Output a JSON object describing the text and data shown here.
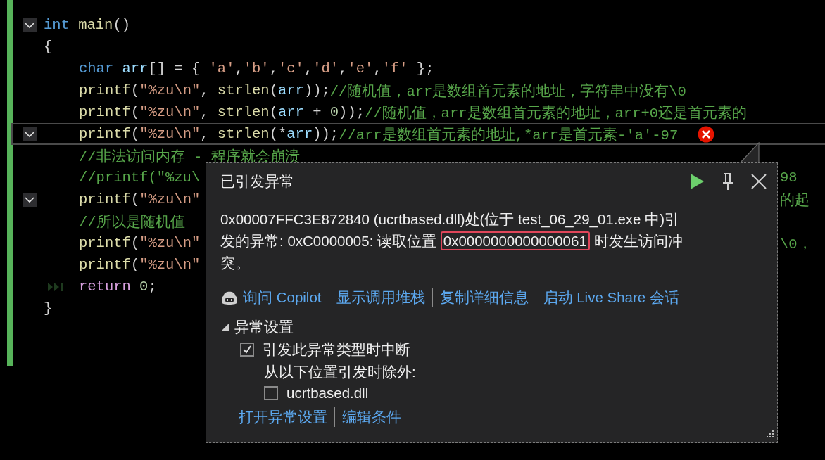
{
  "code_lines": [
    {
      "indented": false,
      "fold": true,
      "current": false,
      "error": false,
      "next_statement": false,
      "tokens": [
        {
          "kind": "keyword",
          "text": "int"
        },
        {
          "kind": "func",
          "text": "main"
        },
        {
          "kind": "plain",
          "text": "()"
        }
      ]
    },
    {
      "indented": false,
      "fold": false,
      "current": false,
      "error": false,
      "next_statement": false,
      "tokens": [
        {
          "kind": "plain",
          "text": "{"
        }
      ]
    },
    {
      "indented": true,
      "fold": false,
      "current": false,
      "error": false,
      "next_statement": false,
      "tokens": [
        {
          "kind": "keyword",
          "text": "char"
        },
        {
          "kind": "var",
          "text": "arr"
        },
        {
          "kind": "plain",
          "text": "[] = { "
        },
        {
          "kind": "string",
          "text": "'a'"
        },
        {
          "kind": "plain",
          "text": ","
        },
        {
          "kind": "string",
          "text": "'b'"
        },
        {
          "kind": "plain",
          "text": ","
        },
        {
          "kind": "string",
          "text": "'c'"
        },
        {
          "kind": "plain",
          "text": ","
        },
        {
          "kind": "string",
          "text": "'d'"
        },
        {
          "kind": "plain",
          "text": ","
        },
        {
          "kind": "string",
          "text": "'e'"
        },
        {
          "kind": "plain",
          "text": ","
        },
        {
          "kind": "string",
          "text": "'f'"
        },
        {
          "kind": "plain",
          "text": " };"
        }
      ]
    },
    {
      "indented": true,
      "fold": false,
      "current": false,
      "error": false,
      "next_statement": false,
      "tokens": [
        {
          "kind": "func",
          "text": "printf"
        },
        {
          "kind": "plain",
          "text": "("
        },
        {
          "kind": "string",
          "text": "\"%zu\\n\""
        },
        {
          "kind": "plain",
          "text": ", "
        },
        {
          "kind": "func",
          "text": "strlen"
        },
        {
          "kind": "plain",
          "text": "("
        },
        {
          "kind": "var",
          "text": "arr"
        },
        {
          "kind": "plain",
          "text": "));"
        },
        {
          "kind": "comment",
          "text": "//随机值，arr是数组首元素的地址，字符串中没有\\0"
        }
      ]
    },
    {
      "indented": true,
      "fold": false,
      "current": false,
      "error": false,
      "next_statement": false,
      "tokens": [
        {
          "kind": "func",
          "text": "printf"
        },
        {
          "kind": "plain",
          "text": "("
        },
        {
          "kind": "string",
          "text": "\"%zu\\n\""
        },
        {
          "kind": "plain",
          "text": ", "
        },
        {
          "kind": "func",
          "text": "strlen"
        },
        {
          "kind": "plain",
          "text": "("
        },
        {
          "kind": "var",
          "text": "arr"
        },
        {
          "kind": "plain",
          "text": " + "
        },
        {
          "kind": "number",
          "text": "0"
        },
        {
          "kind": "plain",
          "text": "));"
        },
        {
          "kind": "comment",
          "text": "//随机值，arr是数组首元素的地址，arr+0还是首元素的"
        }
      ]
    },
    {
      "indented": true,
      "fold": true,
      "current": true,
      "error": true,
      "next_statement": false,
      "tokens": [
        {
          "kind": "func",
          "text": "printf"
        },
        {
          "kind": "plain",
          "text": "("
        },
        {
          "kind": "string",
          "text": "\"%zu\\n\""
        },
        {
          "kind": "plain",
          "text": ", "
        },
        {
          "kind": "func",
          "text": "strlen"
        },
        {
          "kind": "plain",
          "text": "(*"
        },
        {
          "kind": "var",
          "text": "arr"
        },
        {
          "kind": "plain",
          "text": "));"
        },
        {
          "kind": "comment",
          "text": "//arr是数组首元素的地址,*arr是首元素-'a'-97"
        }
      ]
    },
    {
      "indented": true,
      "fold": false,
      "current": false,
      "error": false,
      "next_statement": false,
      "tokens": [
        {
          "kind": "comment",
          "text": "//非法访问内存 - 程序就会崩溃"
        }
      ]
    },
    {
      "indented": true,
      "fold": false,
      "current": false,
      "error": false,
      "next_statement": false,
      "tail": "98",
      "tokens": [
        {
          "kind": "comment",
          "text": "//printf(\"%zu\\"
        }
      ]
    },
    {
      "indented": true,
      "fold": true,
      "current": false,
      "error": false,
      "next_statement": false,
      "tail": "的起",
      "tokens": [
        {
          "kind": "func",
          "text": "printf"
        },
        {
          "kind": "plain",
          "text": "("
        },
        {
          "kind": "string",
          "text": "\"%zu\\n\""
        }
      ]
    },
    {
      "indented": true,
      "fold": false,
      "current": false,
      "error": false,
      "next_statement": false,
      "tokens": [
        {
          "kind": "comment",
          "text": "//所以是随机值"
        }
      ]
    },
    {
      "indented": true,
      "fold": false,
      "current": false,
      "error": false,
      "next_statement": false,
      "tail": "\\0，",
      "tokens": [
        {
          "kind": "func",
          "text": "printf"
        },
        {
          "kind": "plain",
          "text": "("
        },
        {
          "kind": "string",
          "text": "\"%zu\\n\""
        }
      ]
    },
    {
      "indented": true,
      "fold": false,
      "current": false,
      "error": false,
      "next_statement": false,
      "tokens": [
        {
          "kind": "func",
          "text": "printf"
        },
        {
          "kind": "plain",
          "text": "("
        },
        {
          "kind": "string",
          "text": "\"%zu\\n\""
        }
      ]
    },
    {
      "indented": true,
      "fold": false,
      "current": false,
      "error": false,
      "next_statement": true,
      "tokens": [
        {
          "kind": "control",
          "text": "return"
        },
        {
          "kind": "number",
          "text": "0"
        },
        {
          "kind": "plain",
          "text": ";"
        }
      ]
    },
    {
      "indented": false,
      "fold": false,
      "current": false,
      "error": false,
      "next_statement": false,
      "tokens": [
        {
          "kind": "plain",
          "text": "}"
        }
      ]
    }
  ],
  "exception_popup": {
    "title": "已引发异常",
    "message": {
      "before": "0x00007FFC3E872840 (ucrtbased.dll)处(位于 test_06_29_01.exe 中)引发的异常: 0xC0000005: 读取位置",
      "highlight": "0x0000000000000061",
      "after": "时发生访问冲突。"
    },
    "links": [
      {
        "kind": "copilot",
        "text": "询问 Copilot"
      },
      {
        "kind": "plain",
        "text": "显示调用堆栈"
      },
      {
        "kind": "plain",
        "text": "复制详细信息"
      },
      {
        "kind": "plain",
        "text": "启动 Live Share 会话"
      }
    ],
    "settings": {
      "title": "异常设置",
      "expanded": true,
      "break_option": {
        "label": "引发此异常类型时中断",
        "checked": true
      },
      "except_label": "从以下位置引发时除外:",
      "modules": [
        {
          "label": "ucrtbased.dll",
          "checked": false
        }
      ]
    },
    "bottom_links": [
      "打开异常设置",
      "编辑条件"
    ]
  }
}
